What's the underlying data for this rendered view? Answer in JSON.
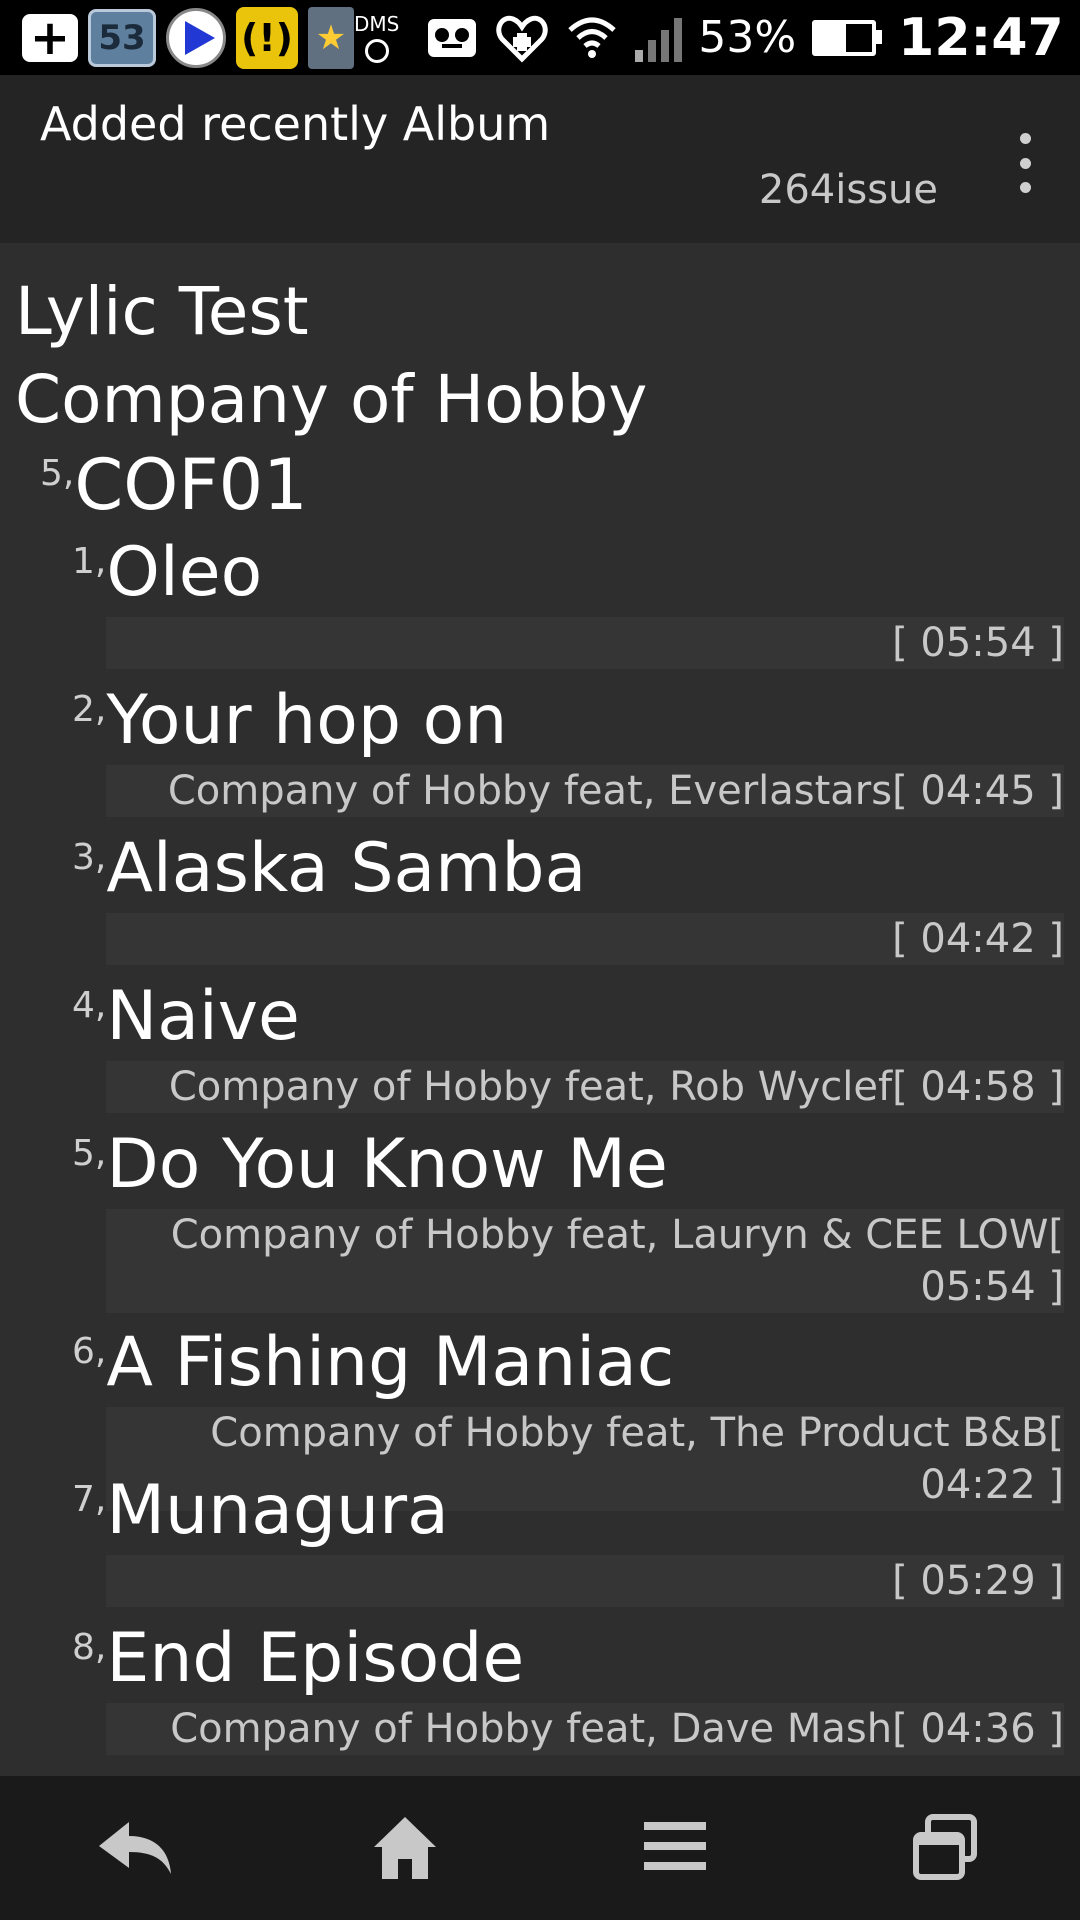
{
  "status_bar": {
    "notifications": [
      "add-icon",
      "calendar-icon",
      "media-play-icon",
      "warning-icon",
      "app-update-icon"
    ],
    "calendar_day": "53",
    "dms_label": "DMS",
    "battery_percent": "53%",
    "time": "12:47",
    "status_icons": [
      "voicemail-icon",
      "health-icon",
      "wifi-icon",
      "signal-icon",
      "battery-icon"
    ]
  },
  "action_bar": {
    "title": "Added recently Album",
    "subtitle": "264issue",
    "overflow_icon": "overflow-menu-icon"
  },
  "content": {
    "song_title": "Lylic Test",
    "artist": "Company of Hobby",
    "album": {
      "number": "5,",
      "name": "COF01"
    },
    "tracks": [
      {
        "number": "1,",
        "title": "Oleo",
        "detail": "[ 05:54 ]"
      },
      {
        "number": "2,",
        "title": "Your hop on",
        "detail": "Company of Hobby feat, Everlastars[ 04:45 ]"
      },
      {
        "number": "3,",
        "title": "Alaska Samba",
        "detail": "[ 04:42 ]"
      },
      {
        "number": "4,",
        "title": "Naive",
        "detail": "Company of Hobby feat, Rob Wyclef[ 04:58 ]"
      },
      {
        "number": "5,",
        "title": "Do You Know Me",
        "detail": "Company of Hobby feat, Lauryn & CEE LOW[ 05:54 ]"
      },
      {
        "number": "6,",
        "title": "A Fishing Maniac",
        "detail": "Company of Hobby feat, The Product B&B[ 04:22 ]"
      },
      {
        "number": "7,",
        "title": "Munagura",
        "detail": "[ 05:29 ]"
      },
      {
        "number": "8,",
        "title": "End Episode",
        "detail": "Company of Hobby feat, Dave Mash[ 04:36 ]"
      }
    ]
  },
  "nav_bar": {
    "buttons": [
      "back-icon",
      "home-icon",
      "menu-icon",
      "recent-apps-icon"
    ]
  },
  "colors": {
    "background": "#2e2e2e",
    "action_bar": "#242424",
    "nav_bar": "#1a1a1a",
    "detail_bg": "#353535",
    "text_primary": "#ffffff",
    "text_secondary": "#c8c8c8"
  }
}
